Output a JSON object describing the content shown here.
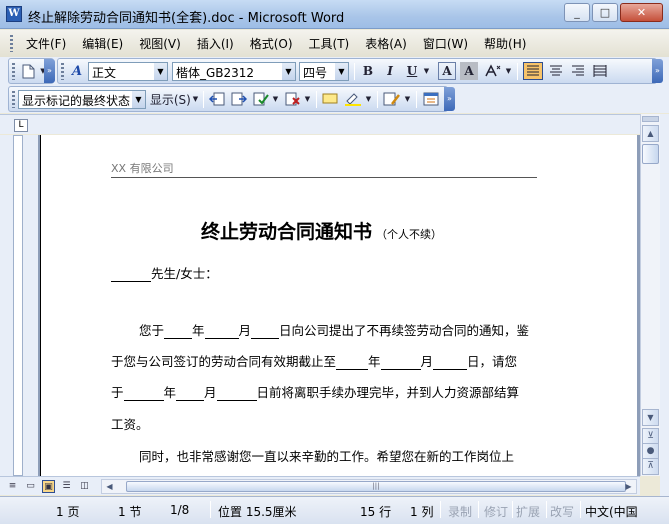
{
  "window": {
    "title": "终止解除劳动合同通知书(全套).doc - Microsoft Word",
    "icon": "word-doc-icon",
    "icon_letter": "W",
    "minimize": "_",
    "maximize": "□",
    "close": "✕"
  },
  "menu": [
    "文件(F)",
    "编辑(E)",
    "视图(V)",
    "插入(I)",
    "格式(O)",
    "工具(T)",
    "表格(A)",
    "窗口(W)",
    "帮助(H)"
  ],
  "formatting": {
    "style": "正文",
    "font": "楷体_GB2312",
    "size": "四号",
    "bold": "B",
    "italic": "I",
    "underline": "U",
    "a_glyph": "A",
    "style_glyph": "A",
    "dd_arrow": "▼",
    "chevron": "»"
  },
  "reviewing": {
    "display_mode": "显示标记的最终状态",
    "show_label": "显示(S)"
  },
  "ruler": {
    "tab_selector": "L"
  },
  "document": {
    "header_company": "XX 有限公司",
    "title": "终止劳动合同通知书",
    "title_note": "（个人不续）",
    "salutation": "先生/女士：",
    "p1_line1": [
      "您于",
      "年",
      "月",
      "日向公司提出了不再续签劳动合同的通知，鉴"
    ],
    "p1_line2": [
      "于您与公司签订的劳动合同有效期截止至",
      "年",
      "月",
      "日，请您"
    ],
    "p1_line3": [
      "于",
      "年",
      "月",
      "日前将离职手续办理完毕，并到人力资源部结算"
    ],
    "p1_line4": "工资。",
    "p2_line1": "同时，也非常感谢您一直以来辛勤的工作。希望您在新的工作岗位上"
  },
  "scrollbar": {
    "up": "▲",
    "down": "▼",
    "prev_page": "⊻",
    "next_page": "⊼",
    "select_browse": "●",
    "left": "◀",
    "right": "▶",
    "grip": "|||"
  },
  "status": {
    "page": "1 页",
    "section": "1 节",
    "page_of": "1/8",
    "position": "位置 15.5厘米",
    "line": "15 行",
    "column": "1 列",
    "rec": "录制",
    "trk": "修订",
    "ext": "扩展",
    "ovr": "改写",
    "language": "中文(中国"
  }
}
